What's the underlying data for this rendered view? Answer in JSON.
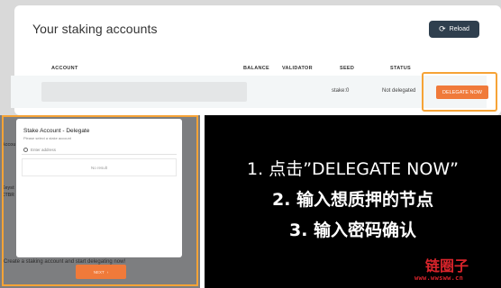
{
  "staking": {
    "title": "Your staking accounts",
    "reload_label": "Reload",
    "columns": {
      "account": "ACCOUNT",
      "balance": "BALANCE",
      "validator": "VALIDATOR",
      "seed": "SEED",
      "status": "STATUS"
    },
    "row": {
      "seed": "stake:0",
      "status": "Not delegated",
      "action": "DELEGATE NOW"
    }
  },
  "modal": {
    "title": "Stake Account - Delegate",
    "subtitle": "Please select a stake account",
    "search_placeholder": "Enter address",
    "empty_result": "No result",
    "next_label": "NEXT"
  },
  "background": {
    "side_text_1": "Accou",
    "side_text_2": "Keyst",
    "side_text_3": "CTBR",
    "bottom_text": "Create a staking account and start delegating now!"
  },
  "instructions": [
    "1. 点击”DELEGATE NOW”",
    "2. 输入想质押的节点",
    "3. 输入密码确认"
  ],
  "watermark": {
    "name": "链圈子",
    "url": "www.wwsww.cn"
  },
  "colors": {
    "accent_orange": "#f07a3a",
    "highlight_orange": "#f6a336",
    "reload_dark": "#2f3f4e",
    "watermark_red": "#d8242b"
  },
  "icons": [
    "reload-icon",
    "search-icon",
    "arrow-right-icon"
  ]
}
